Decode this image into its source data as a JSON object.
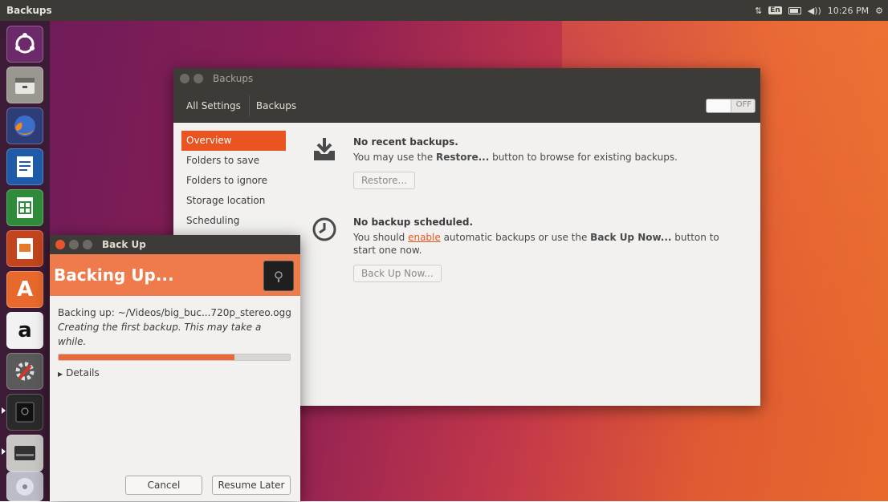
{
  "top_panel": {
    "title": "Backups",
    "indicators": {
      "network_icon": "network-updown-icon",
      "keyboard": "En",
      "battery_icon": "battery-icon",
      "volume": "◀))",
      "time": "10:26 PM",
      "gear_icon": "gear-icon"
    }
  },
  "launcher": {
    "items": [
      {
        "name": "dash"
      },
      {
        "name": "files"
      },
      {
        "name": "firefox"
      },
      {
        "name": "writer"
      },
      {
        "name": "calc"
      },
      {
        "name": "impress"
      },
      {
        "name": "software-center",
        "glyph": "A"
      },
      {
        "name": "amazon",
        "glyph": "a"
      },
      {
        "name": "system-settings"
      },
      {
        "name": "backups"
      },
      {
        "name": "drive"
      },
      {
        "name": "disc"
      }
    ]
  },
  "backups_window": {
    "title": "Backups",
    "header": {
      "all_settings": "All Settings",
      "backups": "Backups",
      "switch_label": "OFF"
    },
    "sidebar": [
      {
        "label": "Overview",
        "active": true
      },
      {
        "label": "Folders to save"
      },
      {
        "label": "Folders to ignore"
      },
      {
        "label": "Storage location"
      },
      {
        "label": "Scheduling"
      }
    ],
    "recent": {
      "title": "No recent backups.",
      "desc_pre": "You may use the ",
      "desc_bold": "Restore...",
      "desc_post": " button to browse for existing backups.",
      "button": "Restore..."
    },
    "scheduled": {
      "title": "No backup scheduled.",
      "desc_pre": "You should ",
      "desc_link": "enable",
      "desc_mid": " automatic backups or use the ",
      "desc_bold": "Back Up Now...",
      "desc_post": " button to start one now.",
      "button": "Back Up Now..."
    }
  },
  "backup_dialog": {
    "title": "Back Up",
    "header": "Backing Up...",
    "file_line": "Backing up: ~/Videos/big_buc...720p_stereo.ogg",
    "status_line": "Creating the first backup.  This may take a while.",
    "progress": 0.76,
    "details": "Details",
    "cancel": "Cancel",
    "resume_later": "Resume Later"
  },
  "colors": {
    "accent": "#e95420",
    "dialog_header": "#ef7a4b",
    "panel": "#3b3a36"
  }
}
